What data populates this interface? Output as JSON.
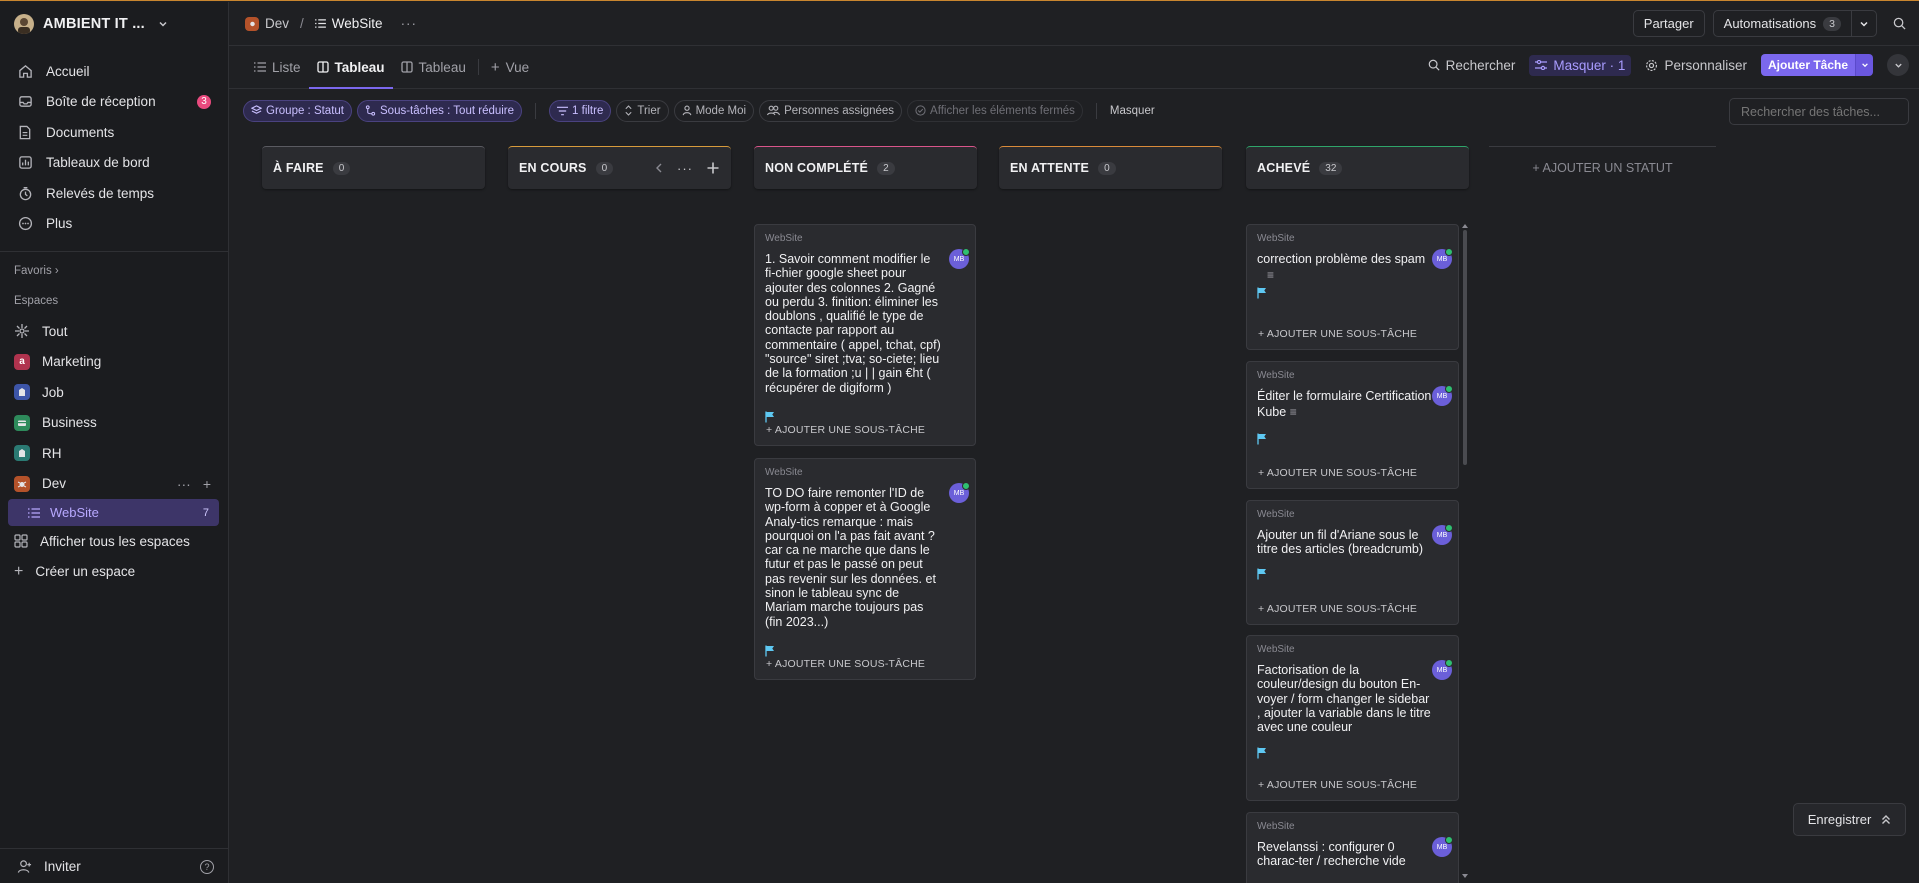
{
  "workspace": {
    "name": "AMBIENT IT ..."
  },
  "nav": [
    {
      "label": "Accueil",
      "icon": "home-icon"
    },
    {
      "label": "Boîte de réception",
      "icon": "inbox-icon",
      "badge": "3"
    },
    {
      "label": "Documents",
      "icon": "document-icon"
    },
    {
      "label": "Tableaux de bord",
      "icon": "dashboard-icon"
    },
    {
      "label": "Relevés de temps",
      "icon": "timesheet-icon"
    },
    {
      "label": "Plus",
      "icon": "more-icon"
    }
  ],
  "sections": {
    "favorites": "Favoris",
    "spaces": "Espaces"
  },
  "spaces": [
    {
      "label": "Tout",
      "icon": "spaces-icon"
    },
    {
      "label": "Marketing",
      "letter": "a",
      "color": "#b0334e"
    },
    {
      "label": "Job",
      "color": "#3d55a8"
    },
    {
      "label": "Business",
      "color": "#2e8a5b"
    },
    {
      "label": "RH",
      "color": "#2b7a73"
    },
    {
      "label": "Dev",
      "color": "#b4522a"
    }
  ],
  "active_list": {
    "label": "WebSite",
    "count": "7"
  },
  "sidebar_links": {
    "all_spaces": "Afficher tous les espaces",
    "create_space": "Créer un espace"
  },
  "footer": {
    "invite": "Inviter",
    "help": "?"
  },
  "breadcrumb": {
    "space": "Dev",
    "sep": "/",
    "list": "WebSite",
    "more": "···"
  },
  "top_actions": {
    "share": "Partager",
    "automations": "Automatisations",
    "automations_count": "3"
  },
  "view_tabs": [
    {
      "label": "Liste",
      "icon": "list-icon"
    },
    {
      "label": "Tableau",
      "icon": "board-icon",
      "active": true
    },
    {
      "label": "Tableau",
      "icon": "board-icon"
    },
    {
      "label": "Vue",
      "icon": "plus-icon"
    }
  ],
  "view_actions": {
    "search": "Rechercher",
    "hide": "Masquer · 1",
    "customize": "Personnaliser",
    "add_task": "Ajouter Tâche"
  },
  "filters": {
    "group": "Groupe : Statut",
    "subtasks": "Sous-tâches : Tout réduire",
    "filter": "1 filtre",
    "sort": "Trier",
    "me_mode": "Mode Moi",
    "assignees": "Personnes assignées",
    "show_closed": "Afficher les éléments fermés",
    "hide": "Masquer",
    "search_placeholder": "Rechercher des tâches..."
  },
  "columns": [
    {
      "title": "À FAIRE",
      "count": "0",
      "color": "#5a5b61"
    },
    {
      "title": "EN COURS",
      "count": "0",
      "color": "#d79b3c"
    },
    {
      "title": "NON COMPLÉTÉ",
      "count": "2",
      "color": "#d9558a"
    },
    {
      "title": "EN ATTENTE",
      "count": "0",
      "color": "#d98b3a"
    },
    {
      "title": "ACHEVÉ",
      "count": "32",
      "color": "#2fa56a"
    }
  ],
  "add_status": "+ AJOUTER UN STATUT",
  "cards": {
    "ws_label": "WebSite",
    "subtask_label": "+ AJOUTER UNE SOUS-TÂCHE",
    "avatar": "MB",
    "desc_glyph": "≡",
    "non_complete": [
      {
        "title": "1. Savoir comment modifier le fi-chier google sheet pour ajouter des colonnes 2. Gagné ou perdu 3. finition: éliminer les doublons , qualifié le type de contacte par rapport au commentaire ( appel, tchat, cpf) \"source\" siret ;tva; so-ciete; lieu de la formation ;u | | gain €ht ( récupérer de digiform )"
      },
      {
        "title": "TO DO faire remonter l'ID de wp-form à copper et à Google Analy-tics remarque : mais pourquoi on l'a pas fait avant ? car ca ne marche que dans le futur et pas le passé on peut pas revenir sur les données. et sinon le tableau sync de Mariam marche toujours pas (fin 2023...)"
      }
    ],
    "acheve": [
      {
        "title": "correction problème des spam"
      },
      {
        "title": "Éditer le formulaire Certification Kube"
      },
      {
        "title": "Ajouter un fil d'Ariane sous le titre des articles (breadcrumb)"
      },
      {
        "title": "Factorisation de la couleur/design du bouton En-voyer / form changer le sidebar , ajouter la variable dans le titre avec une couleur"
      },
      {
        "title": "Revelanssi : configurer 0 charac-ter / recherche vide"
      }
    ]
  },
  "save": "Enregistrer",
  "colors": {
    "accent": "#7b68ee",
    "flag": "#5ec8f2",
    "badge": "#e94a7e"
  }
}
